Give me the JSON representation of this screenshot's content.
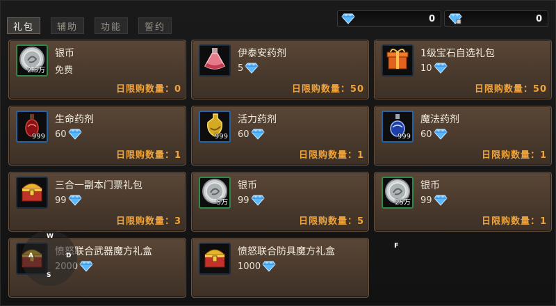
{
  "tabs": [
    "礼包",
    "辅助",
    "功能",
    "誓约"
  ],
  "currency": [
    {
      "icon": "blue-diamond-icon",
      "value": "0"
    },
    {
      "icon": "blue-diamond-lock-icon",
      "value": "0"
    }
  ],
  "items": [
    {
      "name": "银币",
      "icon": "silver-coin-icon",
      "qty": "2.5万",
      "price": "免费",
      "price_icon": false,
      "limit": "日限购数量：0"
    },
    {
      "name": "伊泰安药剂",
      "icon": "red-potion-flask-icon",
      "qty": "",
      "price": "5",
      "price_icon": true,
      "limit": "日限购数量：50"
    },
    {
      "name": "1级宝石自选礼包",
      "icon": "orange-gift-box-icon",
      "qty": "",
      "price": "10",
      "price_icon": true,
      "limit": "日限购数量：50"
    },
    {
      "name": "生命药剂",
      "icon": "red-health-potion-icon",
      "qty": "999",
      "price": "60",
      "price_icon": true,
      "limit": "日限购数量：1"
    },
    {
      "name": "活力药剂",
      "icon": "yellow-vigor-potion-icon",
      "qty": "999",
      "price": "60",
      "price_icon": true,
      "limit": "日限购数量：1"
    },
    {
      "name": "魔法药剂",
      "icon": "blue-mana-potion-icon",
      "qty": "999",
      "price": "60",
      "price_icon": true,
      "limit": "日限购数量：1"
    },
    {
      "name": "三合一副本门票礼包",
      "icon": "treasure-chest-icon",
      "qty": "",
      "price": "99",
      "price_icon": true,
      "limit": "日限购数量：3"
    },
    {
      "name": "银币",
      "icon": "silver-coin-icon",
      "qty": "5万",
      "price": "99",
      "price_icon": true,
      "limit": "日限购数量：5"
    },
    {
      "name": "银币",
      "icon": "silver-coin-icon",
      "qty": "25万",
      "price": "99",
      "price_icon": true,
      "limit": "日限购数量：1"
    },
    {
      "name": "愤怒联合武器魔方礼盒",
      "icon": "treasure-chest-icon",
      "qty": "",
      "price": "2000",
      "price_icon": true,
      "limit": ""
    },
    {
      "name": "愤怒联合防具魔方礼盒",
      "icon": "treasure-chest-icon",
      "qty": "",
      "price": "1000",
      "price_icon": true,
      "limit": ""
    }
  ],
  "overlay_keys": {
    "w": "W",
    "a": "A",
    "s": "S",
    "d": "D",
    "f": "F"
  },
  "colors": {
    "limit_text": "#f0a43a",
    "diamond": "#5ab8ff",
    "card_bg": "#4a3a2d"
  }
}
